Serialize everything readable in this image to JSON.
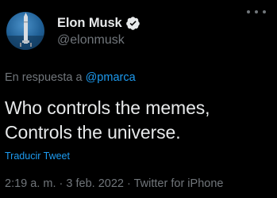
{
  "author": {
    "display_name": "Elon Musk",
    "handle": "@elonmusk",
    "verified": true,
    "avatar_icon": "rocket-avatar"
  },
  "reply": {
    "prefix": "En respuesta a",
    "mention": "@pmarca"
  },
  "tweet": {
    "lines": [
      "Who controls the memes,",
      "Controls the universe."
    ]
  },
  "translate_label": "Traducir Tweet",
  "meta": {
    "time": "2:19 a. m.",
    "separator1": "·",
    "date": "3 feb. 2022",
    "separator2": "·",
    "source": "Twitter for iPhone"
  },
  "colors": {
    "background": "#000000",
    "text": "#e7e9ea",
    "muted": "#71767b",
    "accent": "#1d9bf0"
  }
}
